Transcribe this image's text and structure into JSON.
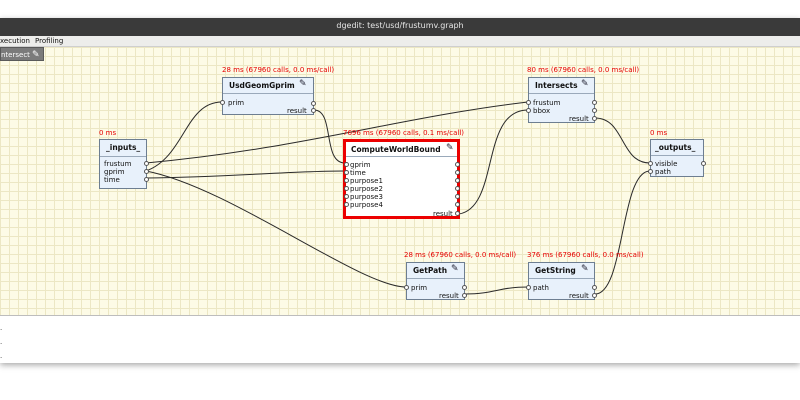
{
  "window": {
    "title": "dgedit: test/usd/frustumv.graph"
  },
  "menu": {
    "items": [
      "xecution",
      "Profiling"
    ]
  },
  "toolbar": {
    "intersect_label": "ntersect"
  },
  "nodes": {
    "inputs": {
      "title": "_inputs_",
      "timing": "0 ms",
      "outputs": [
        "frustum",
        "gprim",
        "time"
      ]
    },
    "usdgeomgprim": {
      "title": "UsdGeomGprim",
      "timing": "28 ms (67960 calls, 0.0 ms/call)",
      "inputs": [
        "prim"
      ],
      "output": "result"
    },
    "computeworldbound": {
      "title": "ComputeWorldBound",
      "timing": "7696 ms (67960 calls, 0.1 ms/call)",
      "inputs": [
        "gprim",
        "time",
        "purpose1",
        "purpose2",
        "purpose3",
        "purpose4"
      ],
      "output": "result"
    },
    "intersects": {
      "title": "Intersects",
      "timing": "80 ms (67960 calls, 0.0 ms/call)",
      "inputs": [
        "frustum",
        "bbox"
      ],
      "output": "result"
    },
    "outputs": {
      "title": "_outputs_",
      "timing": "0 ms",
      "inputs": [
        "visible",
        "path"
      ]
    },
    "getpath": {
      "title": "GetPath",
      "timing": "28 ms (67960 calls, 0.0 ms/call)",
      "inputs": [
        "prim"
      ],
      "output": "result"
    },
    "getstring": {
      "title": "GetString",
      "timing": "376 ms (67960 calls, 0.0 ms/call)",
      "inputs": [
        "path"
      ],
      "output": "result"
    }
  },
  "log": {
    "lines": [
      ".",
      ".",
      "."
    ]
  },
  "colors": {
    "accent": "#ec0000",
    "timing": "#e60000",
    "node_fill": "#e8f1fb",
    "canvas": "#fdfbe6"
  }
}
